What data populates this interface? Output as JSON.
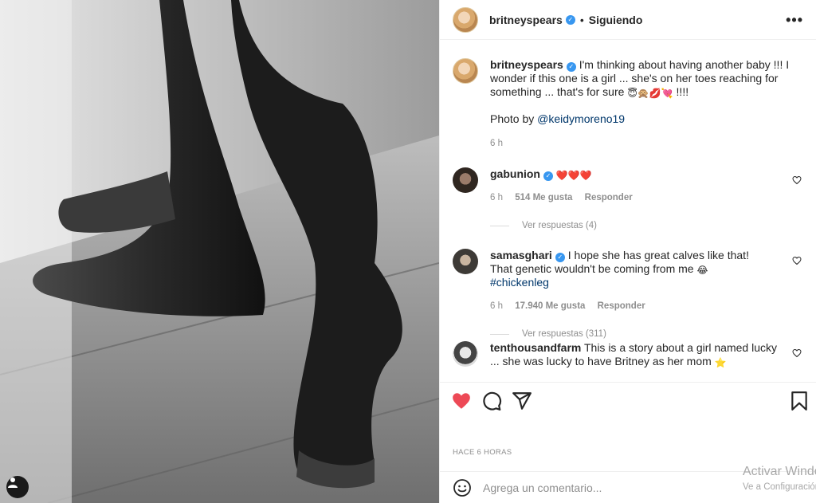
{
  "post": {
    "author": "britneyspears",
    "follow_status": "Siguiendo",
    "separator": "•",
    "more_glyph": "•••"
  },
  "caption": {
    "user": "britneyspears",
    "text": "I'm thinking about having another baby !!! I wonder if this one is a girl ... she's on her toes reaching for something ... that's for sure",
    "emojis": "😇🙊💋💘",
    "suffix": "!!!!",
    "credit_prefix": "Photo by",
    "credit_handle": "@keidymoreno19",
    "time": "6 h"
  },
  "comments": [
    {
      "user": "gabunion",
      "text": "❤️❤️❤️",
      "time": "6 h",
      "likes": "514 Me gusta",
      "reply_label": "Responder",
      "view_replies": "Ver respuestas (4)"
    },
    {
      "user": "samasghari",
      "text": "I hope she has great calves like that! That genetic wouldn't be coming from me",
      "emoji": "😂",
      "hashtag": "#chickenleg",
      "time": "6 h",
      "likes": "17.940 Me gusta",
      "reply_label": "Responder",
      "view_replies": "Ver respuestas (311)"
    },
    {
      "user": "tenthousandfarm",
      "text": "This is a story about a girl named lucky ... she was lucky to have Britney as her mom",
      "emoji": "⭐"
    }
  ],
  "actions": {
    "like_icon": "heart-icon-filled",
    "comment_icon": "comment-icon",
    "share_icon": "share-icon",
    "save_icon": "bookmark-icon",
    "like_color": "#ed4956"
  },
  "timestamp": "HACE 6 HORAS",
  "add_comment": {
    "placeholder": "Agrega un comentario..."
  },
  "watermark": {
    "title": "Activar Windows",
    "subtitle": "Ve a Configuración"
  }
}
